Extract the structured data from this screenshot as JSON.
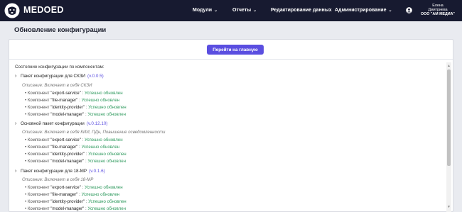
{
  "header": {
    "brand": "MEDOED",
    "logo_icon": "dog-head-logo",
    "nav": [
      {
        "label": "Модули"
      },
      {
        "label": "Отчеты"
      },
      {
        "label": "Редактирование данных"
      },
      {
        "label": "Администрирование"
      }
    ],
    "user": {
      "first_name": "Елена",
      "last_name": "Дмитриева",
      "org": "ООО \"АМ МЕДИА\""
    }
  },
  "page": {
    "title": "Обновление конфигурации",
    "home_button": "Перейти на главную",
    "section_title": "Состояние конфигурации по компонентам:"
  },
  "colors": {
    "topbar": "#171a30",
    "accent": "#5a4ee0",
    "success": "#2f9a5e"
  },
  "packages": [
    {
      "title": "Пакет конфигурации для СКЗИ",
      "version": "(v.0.0.5)",
      "description": "Описание: Включает в себя СКЗИ",
      "components": [
        {
          "prefix": "• Компонент",
          "name": "\"export-service\"",
          "sep": ":",
          "status": "Успешно обновлен"
        },
        {
          "prefix": "• Компонент",
          "name": "\"file-manager\"",
          "sep": ":",
          "status": "Успешно обновлен"
        },
        {
          "prefix": "• Компонент",
          "name": "\"identity-provider\"",
          "sep": ":",
          "status": "Успешно обновлен"
        },
        {
          "prefix": "• Компонент",
          "name": "\"model-manager\"",
          "sep": ":",
          "status": "Успешно обновлен"
        }
      ]
    },
    {
      "title": "Основной пакет конфигурации",
      "version": "(v.0.12.10)",
      "description": "Описание: Включает в себя КИИ, ПДн, Повышение осведомленности",
      "components": [
        {
          "prefix": "• Компонент",
          "name": "\"export-service\"",
          "sep": ":",
          "status": "Успешно обновлен"
        },
        {
          "prefix": "• Компонент",
          "name": "\"file-manager\"",
          "sep": ":",
          "status": "Успешно обновлен"
        },
        {
          "prefix": "• Компонент",
          "name": "\"identity-provider\"",
          "sep": ":",
          "status": "Успешно обновлен"
        },
        {
          "prefix": "• Компонент",
          "name": "\"model-manager\"",
          "sep": ":",
          "status": "Успешно обновлен"
        }
      ]
    },
    {
      "title": "Пакет конфигурации для 18-МР",
      "version": "(v.0.1.6)",
      "description": "Описание: Включает в себя 18-МР",
      "components": [
        {
          "prefix": "• Компонент",
          "name": "\"export-service\"",
          "sep": ":",
          "status": "Успешно обновлен"
        },
        {
          "prefix": "• Компонент",
          "name": "\"file-manager\"",
          "sep": ":",
          "status": "Успешно обновлен"
        },
        {
          "prefix": "• Компонент",
          "name": "\"identity-provider\"",
          "sep": ":",
          "status": "Успешно обновлен"
        },
        {
          "prefix": "• Компонент",
          "name": "\"model-manager\"",
          "sep": ":",
          "status": "Успешно обновлен"
        }
      ]
    }
  ]
}
